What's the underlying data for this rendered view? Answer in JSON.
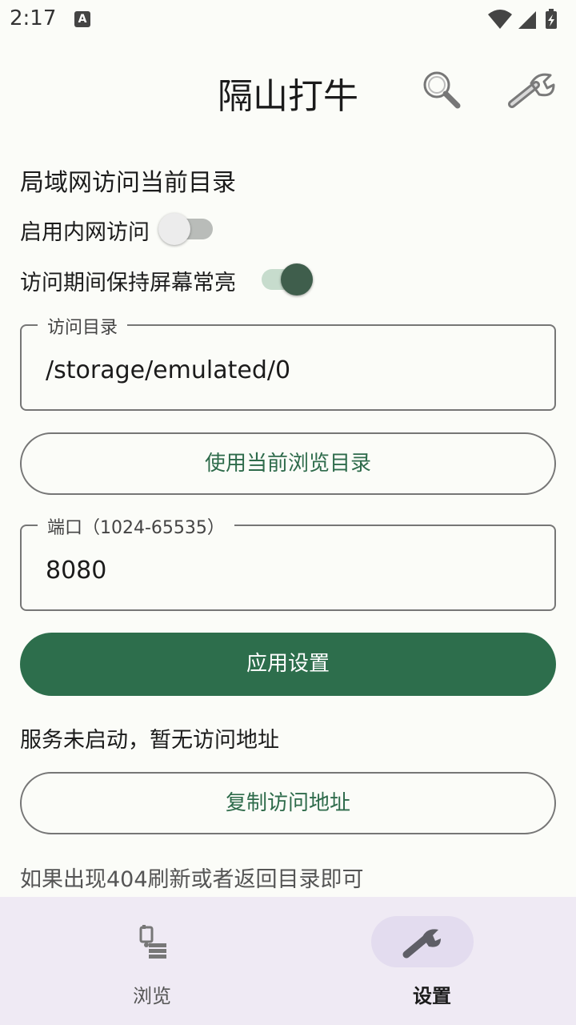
{
  "status_bar": {
    "time": "2:17",
    "notification_icon": "A"
  },
  "app_bar": {
    "title": "隔山打牛",
    "icons": [
      "search-icon",
      "wrench-icon"
    ]
  },
  "settings": {
    "section_title": "局域网访问当前目录",
    "lan_access": {
      "label": "启用内网访问",
      "enabled": false
    },
    "keep_screen_on": {
      "label": "访问期间保持屏幕常亮",
      "enabled": true
    },
    "directory_field": {
      "label": "访问目录",
      "value": "/storage/emulated/0"
    },
    "use_current_dir_button": "使用当前浏览目录",
    "port_field": {
      "label": "端口（1024-65535）",
      "value": "8080"
    },
    "apply_button": "应用设置",
    "status_text": "服务未启动，暂无访问地址",
    "copy_address_button": "复制访问地址",
    "hint_text": "如果出现404刷新或者返回目录即可"
  },
  "bottom_nav": {
    "items": [
      {
        "label": "浏览",
        "icon": "browse-icon",
        "selected": false
      },
      {
        "label": "设置",
        "icon": "wrench-icon",
        "selected": true
      }
    ]
  },
  "colors": {
    "primary": "#2d6e4c",
    "background": "#fbfcf8",
    "nav_background": "#efeaf4",
    "nav_indicator": "#e3dcef"
  }
}
